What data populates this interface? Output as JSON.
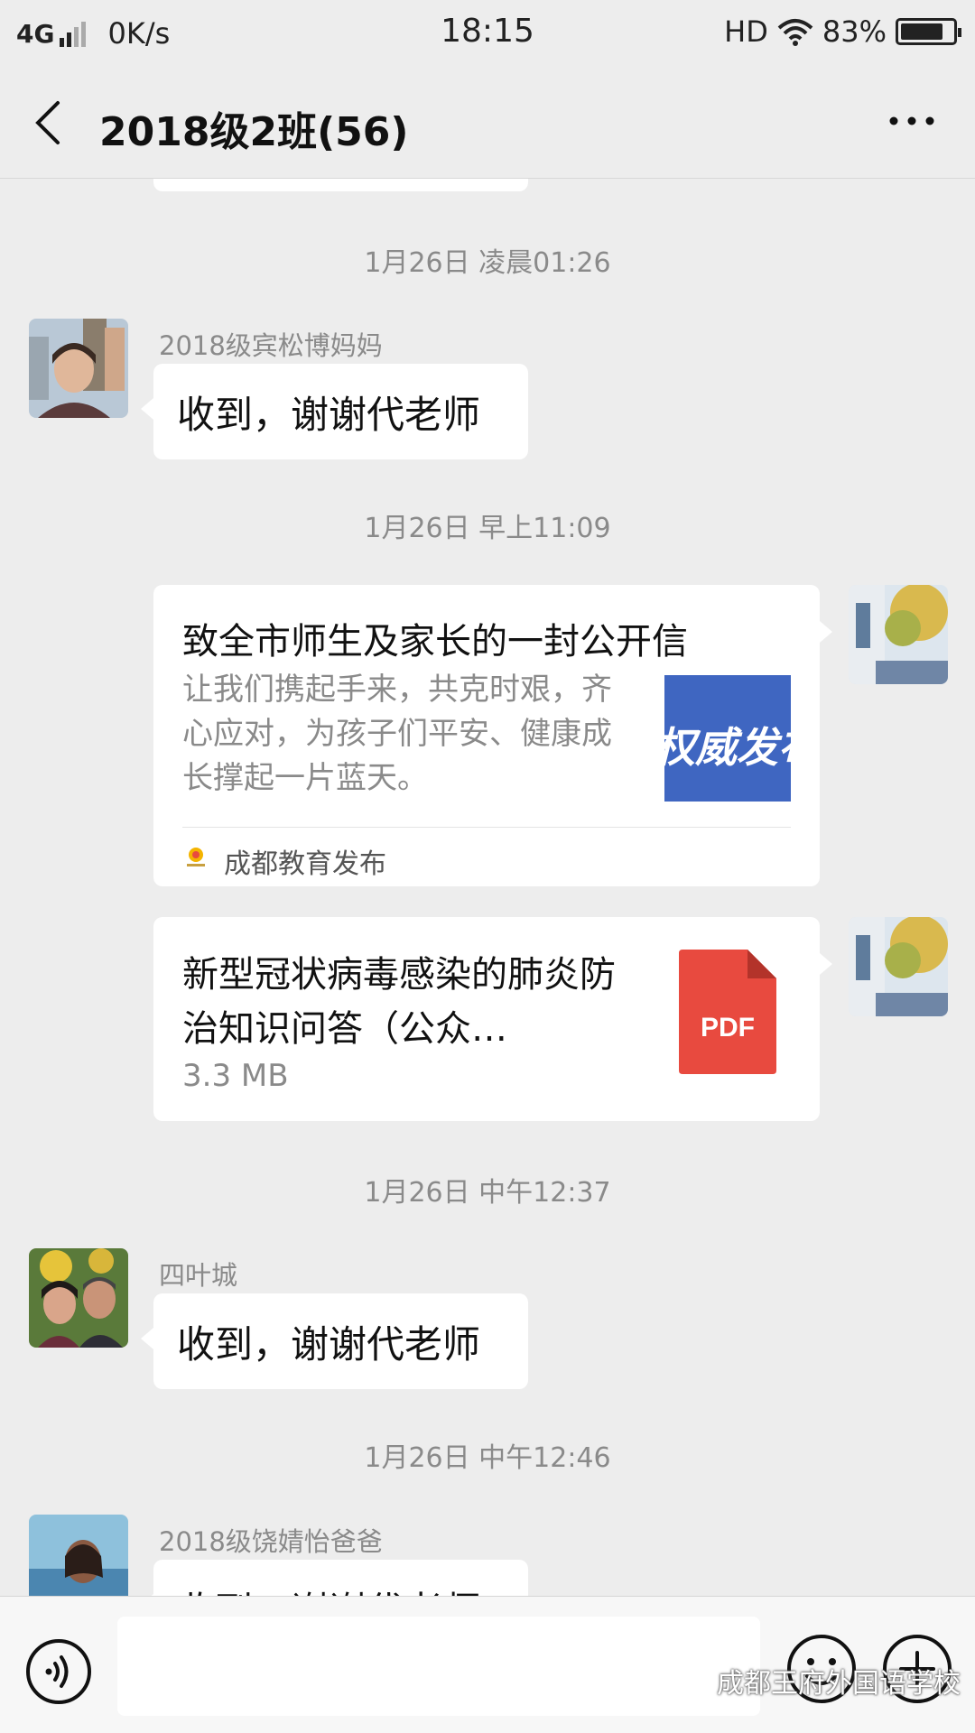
{
  "status_bar": {
    "network": "4G",
    "speed": "0K/s",
    "time": "18:15",
    "hd": "HD",
    "battery_percent": "83%",
    "battery_level": 0.83
  },
  "header": {
    "title": "2018级2班(56)",
    "back_icon": "chevron-left-icon",
    "more_icon": "more-dots-icon"
  },
  "messages": {
    "ts1": "1月26日 凌晨01:26",
    "msg1": {
      "sender": "2018级宾松博妈妈",
      "text": "收到，谢谢代老师"
    },
    "ts2": "1月26日 早上11:09",
    "article": {
      "title": "致全市师生及家长的一封公开信",
      "description": "让我们携起手来，共克时艰，齐心应对，为孩子们平安、健康成长撑起一片蓝天。",
      "thumb_text": "权威发布",
      "source": "成都教育发布"
    },
    "file": {
      "name": "新型冠状病毒感染的肺炎防治知识问答（公众…",
      "size": "3.3 MB",
      "icon_label": "PDF"
    },
    "ts3": "1月26日 中午12:37",
    "msg2": {
      "sender": "四叶城",
      "text": "收到，谢谢代老师"
    },
    "ts4": "1月26日 中午12:46",
    "msg3": {
      "sender": "2018级饶婧怡爸爸",
      "text": "收到，谢谢代老师"
    }
  },
  "input_bar": {
    "placeholder": "",
    "voice_icon": "voice-icon",
    "emoji_icon": "emoji-icon",
    "plus_icon": "plus-icon"
  },
  "watermark": "成都王府外国语学校",
  "colors": {
    "background": "#ededed",
    "bubble": "#ffffff",
    "pdf_red": "#e84a3f",
    "thumb_blue": "#3f66c1"
  }
}
